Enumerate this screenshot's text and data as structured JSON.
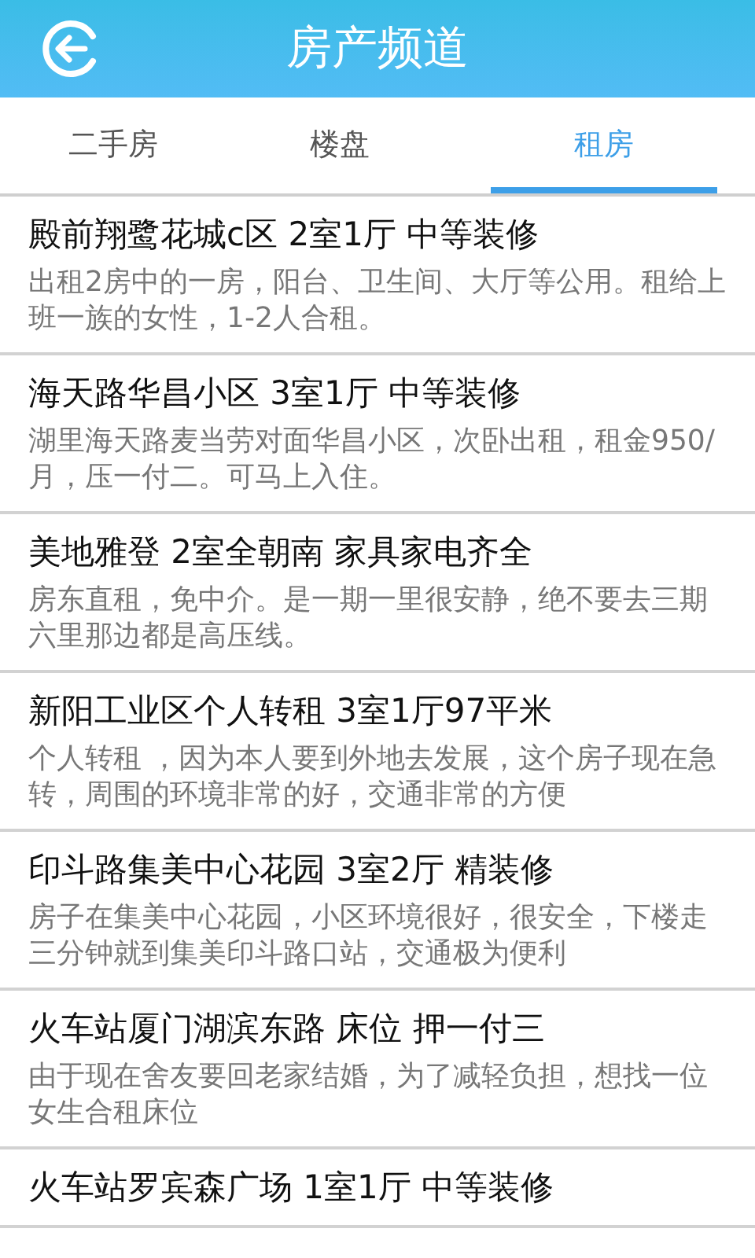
{
  "header": {
    "title": "房产频道"
  },
  "tabs": [
    {
      "label": "二手房",
      "selected": false
    },
    {
      "label": "楼盘",
      "selected": false
    },
    {
      "label": "租房",
      "selected": true
    }
  ],
  "listings": [
    {
      "title": "殿前翔鹭花城c区 2室1厅 中等装修",
      "description": "出租2房中的一房，阳台、卫生间、大厅等公用。租给上班一族的女性，1-2人合租。"
    },
    {
      "title": "海天路华昌小区 3室1厅 中等装修",
      "description": "湖里海天路麦当劳对面华昌小区，次卧出租，租金950/月，压一付二。可马上入住。"
    },
    {
      "title": "美地雅登 2室全朝南 家具家电齐全",
      "description": "房东直租，免中介。是一期一里很安静，绝不要去三期六里那边都是高压线。"
    },
    {
      "title": "新阳工业区个人转租 3室1厅97平米",
      "description": "个人转租 ，因为本人要到外地去发展，这个房子现在急转，周围的环境非常的好，交通非常的方便"
    },
    {
      "title": "印斗路集美中心花园 3室2厅 精装修",
      "description": "房子在集美中心花园，小区环境很好，很安全，下楼走三分钟就到集美印斗路口站，交通极为便利"
    },
    {
      "title": "火车站厦门湖滨东路 床位 押一付三",
      "description": "由于现在舍友要回老家结婚，为了减轻负担，想找一位女生合租床位"
    },
    {
      "title": "火车站罗宾森广场 1室1厅 中等装修"
    }
  ]
}
